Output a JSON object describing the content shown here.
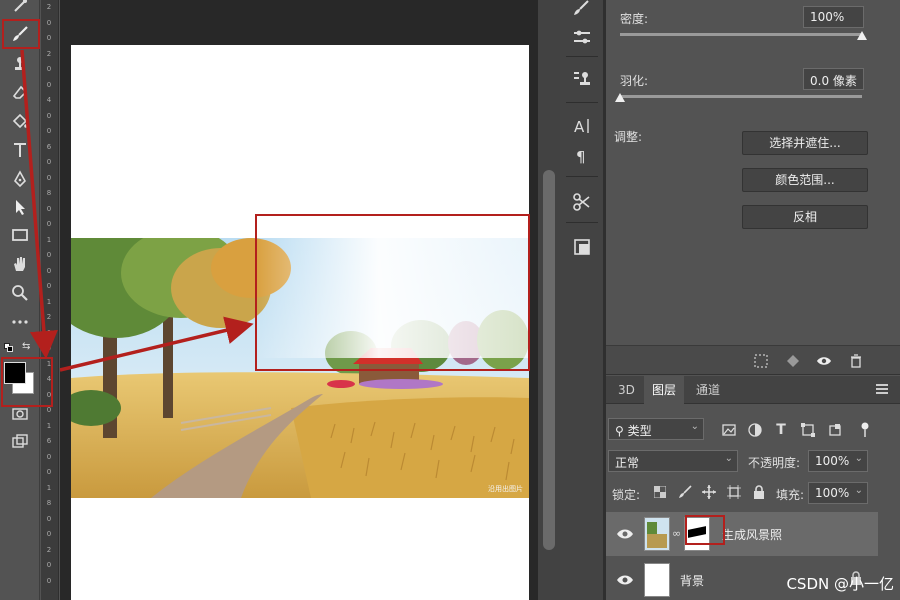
{
  "properties": {
    "density_label": "密度:",
    "density_value": "100%",
    "density_fraction": 1.0,
    "feather_label": "羽化:",
    "feather_value": "0.0 像素",
    "feather_fraction": 0.0,
    "adjust_label": "调整:",
    "buttons": [
      "选择并遮住...",
      "颜色范围...",
      "反相"
    ]
  },
  "ruler_numbers": [
    "2",
    "0",
    "0",
    "2",
    "0",
    "0",
    "4",
    "0",
    "0",
    "6",
    "0",
    "0",
    "8",
    "0",
    "0",
    "1",
    "0",
    "0",
    "0",
    "1",
    "2",
    "0",
    "0",
    "1",
    "4",
    "0",
    "0",
    "1",
    "6",
    "0",
    "0",
    "1",
    "8",
    "0",
    "0",
    "2",
    "0",
    "0"
  ],
  "layers_panel": {
    "tabs": [
      "3D",
      "图层",
      "通道"
    ],
    "active_tab": "图层",
    "filter_kind": "类型",
    "blend_mode": "正常",
    "opacity_label": "不透明度:",
    "opacity_value": "100%",
    "lock_label": "锁定:",
    "fill_label": "填充:",
    "fill_value": "100%",
    "layers": [
      {
        "name": "生成风景照",
        "selected": true,
        "has_mask": true
      },
      {
        "name": "背景",
        "selected": false,
        "has_mask": false
      }
    ]
  },
  "colors": {
    "foreground": "#000000",
    "background": "#ffffff",
    "annotation": "#b3201d",
    "panel": "#535353"
  },
  "icons": {
    "tools": [
      "healing-icon",
      "brush-icon",
      "stamp-icon",
      "eraser-icon",
      "paint-bucket-icon",
      "text-icon",
      "pen-icon",
      "path-select-icon",
      "rectangle-icon",
      "hand-icon",
      "zoom-icon",
      "more-tools-icon"
    ],
    "mid_column": [
      "brush-settings-icon",
      "adjust-icon",
      "stamp-source-icon",
      "character-icon",
      "paragraph-icon",
      "tool-presets-icon",
      "history-icon"
    ]
  },
  "scene_mark": "沿用出图片",
  "watermark": "CSDN @小一亿"
}
